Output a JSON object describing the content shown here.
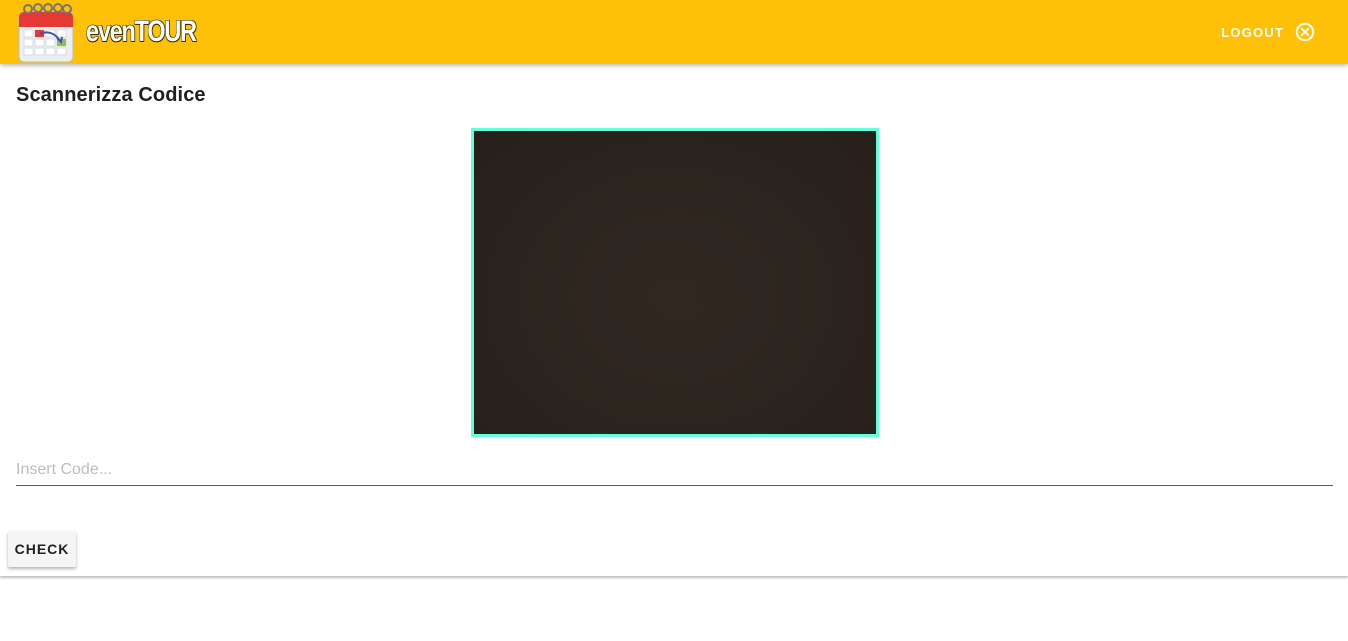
{
  "app_bar": {
    "brand_name": "evenTOUR",
    "logo_icon": "calendar-icon",
    "logout_label": "LOGOUT",
    "logout_icon": "close-circle-icon",
    "background_color": "#ffc107"
  },
  "scan": {
    "title": "Scannerizza Codice",
    "frame_color": "#64ffda",
    "code_input": {
      "value": "",
      "placeholder": "Insert Code..."
    },
    "check_label": "CHECK"
  }
}
